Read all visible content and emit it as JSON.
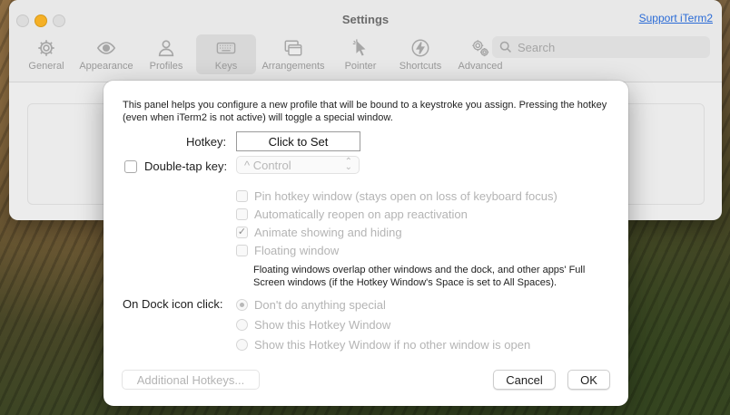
{
  "window": {
    "title": "Settings",
    "support_link": "Support iTerm2",
    "search_placeholder": "Search"
  },
  "toolbar": {
    "items": [
      {
        "label": "General",
        "icon": "gear-icon",
        "selected": false
      },
      {
        "label": "Appearance",
        "icon": "eye-icon",
        "selected": false
      },
      {
        "label": "Profiles",
        "icon": "person-icon",
        "selected": false
      },
      {
        "label": "Keys",
        "icon": "keyboard-icon",
        "selected": true
      },
      {
        "label": "Arrangements",
        "icon": "windows-icon",
        "selected": false
      },
      {
        "label": "Pointer",
        "icon": "cursor-icon",
        "selected": false
      },
      {
        "label": "Shortcuts",
        "icon": "bolt-icon",
        "selected": false
      },
      {
        "label": "Advanced",
        "icon": "gears-icon",
        "selected": false
      }
    ]
  },
  "sheet": {
    "intro": "This panel helps you configure a new profile that will be bound to a keystroke you assign. Pressing the hotkey (even when iTerm2 is not active) will toggle a special window.",
    "hotkey_label": "Hotkey:",
    "hotkey_button": "Click to Set",
    "double_tap_label": "Double-tap key:",
    "double_tap_checked": false,
    "double_tap_select": "^ Control",
    "options": [
      {
        "label": "Pin hotkey window (stays open on loss of keyboard focus)",
        "checked": false
      },
      {
        "label": "Automatically reopen on app reactivation",
        "checked": false
      },
      {
        "label": "Animate showing and hiding",
        "checked": true
      },
      {
        "label": "Floating window",
        "checked": false
      }
    ],
    "floating_note": "Floating windows overlap other windows and the dock, and other apps' Full Screen windows (if the Hotkey Window's Space is set to All Spaces).",
    "dock_label": "On Dock icon click:",
    "dock_options": [
      {
        "label": "Don't do anything special",
        "selected": true
      },
      {
        "label": "Show this Hotkey Window",
        "selected": false
      },
      {
        "label": "Show this Hotkey Window if no other window is open",
        "selected": false
      }
    ],
    "additional_button": "Additional Hotkeys...",
    "cancel_button": "Cancel",
    "ok_button": "OK"
  }
}
